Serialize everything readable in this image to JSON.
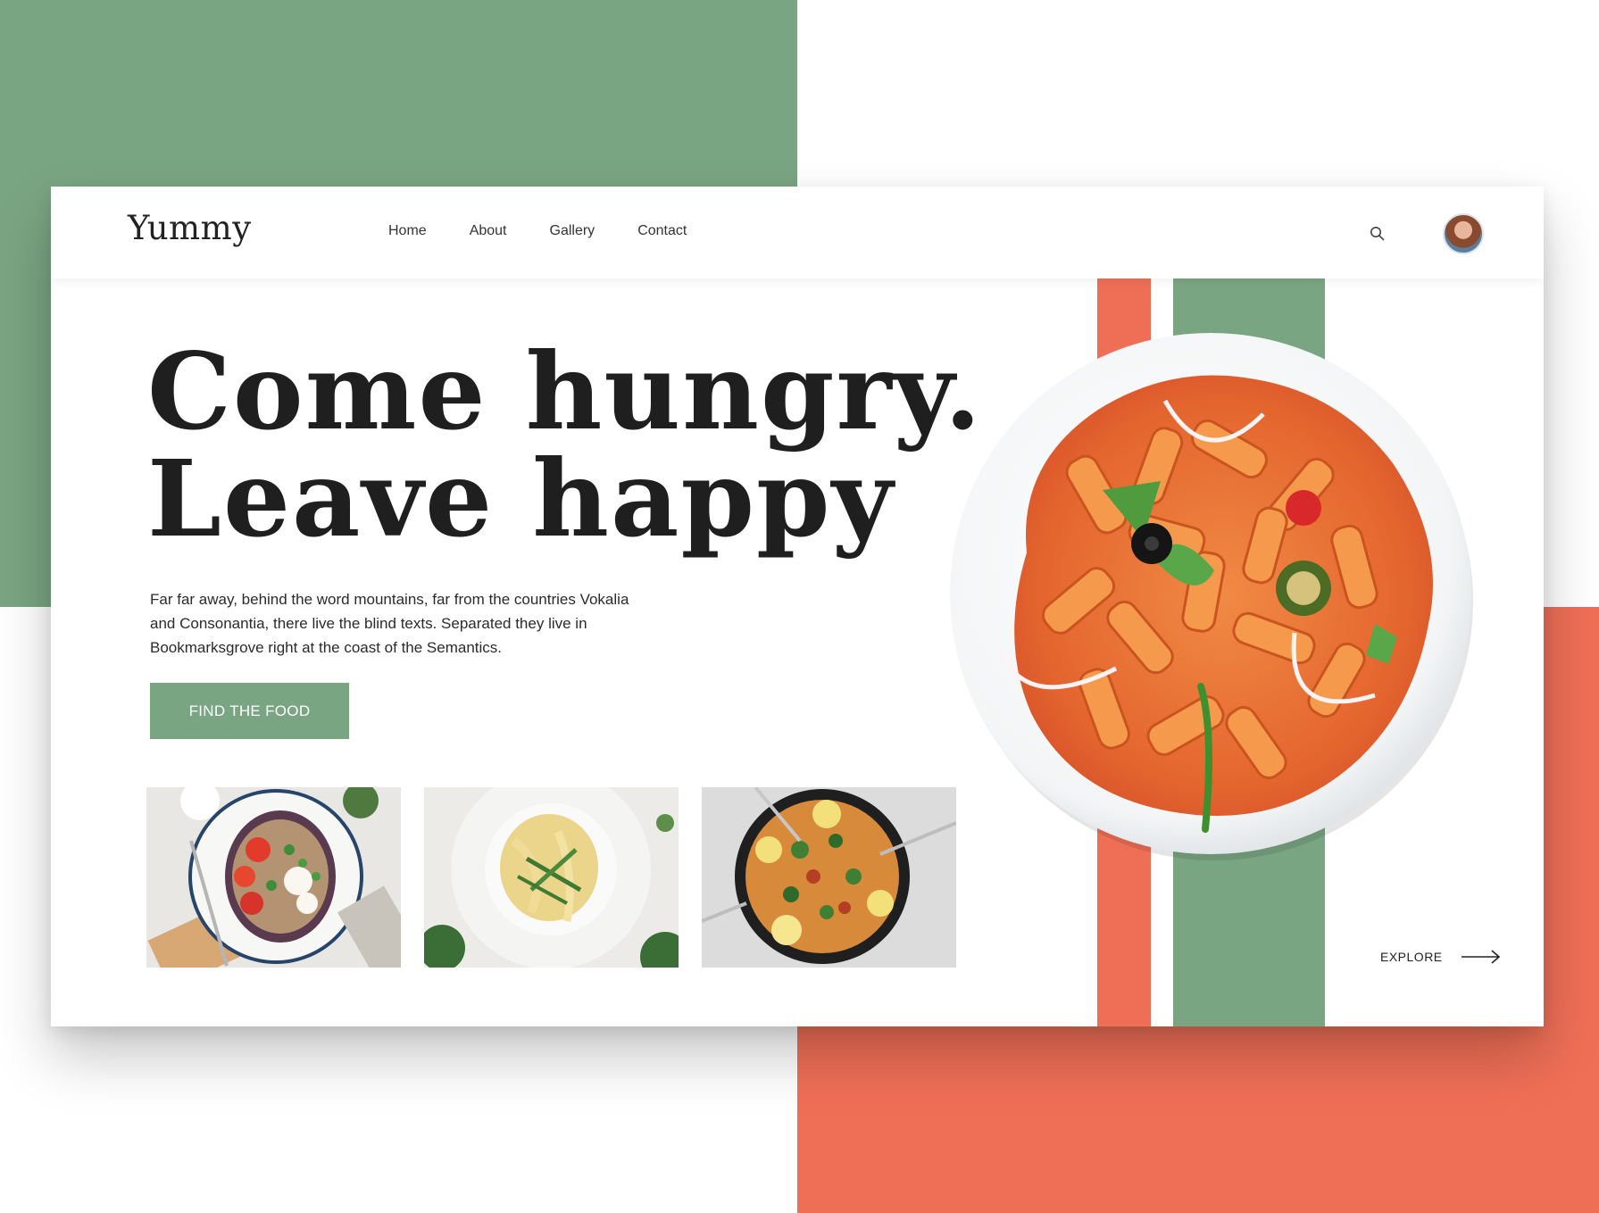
{
  "brand": {
    "logo": "Yummy"
  },
  "nav": {
    "links": [
      "Home",
      "About",
      "Gallery",
      "Contact"
    ],
    "icons": {
      "search": "search-icon",
      "profile": "avatar"
    }
  },
  "hero": {
    "headline_line1": "Come hungry.",
    "headline_line2": "Leave happy",
    "description": "Far far away, behind the word mountains, far from the countries Vokalia and Consonantia, there live the blind texts. Separated they live in Bookmarksgrove right at the coast of the Semantics.",
    "cta_label": "FIND THE FOOD"
  },
  "gallery": {
    "items": [
      "roasted-eggplant-salad-photo",
      "pasta-ribbons-bowl-photo",
      "seafood-rice-pan-photo"
    ]
  },
  "featured": {
    "image": "penne-arrabbiata-plate-photo"
  },
  "explore": {
    "label": "EXPLORE",
    "icon": "arrow-right-icon"
  },
  "colors": {
    "green": "#7aa583",
    "coral": "#ef6f56",
    "text": "#1f1f1f",
    "white": "#ffffff"
  }
}
